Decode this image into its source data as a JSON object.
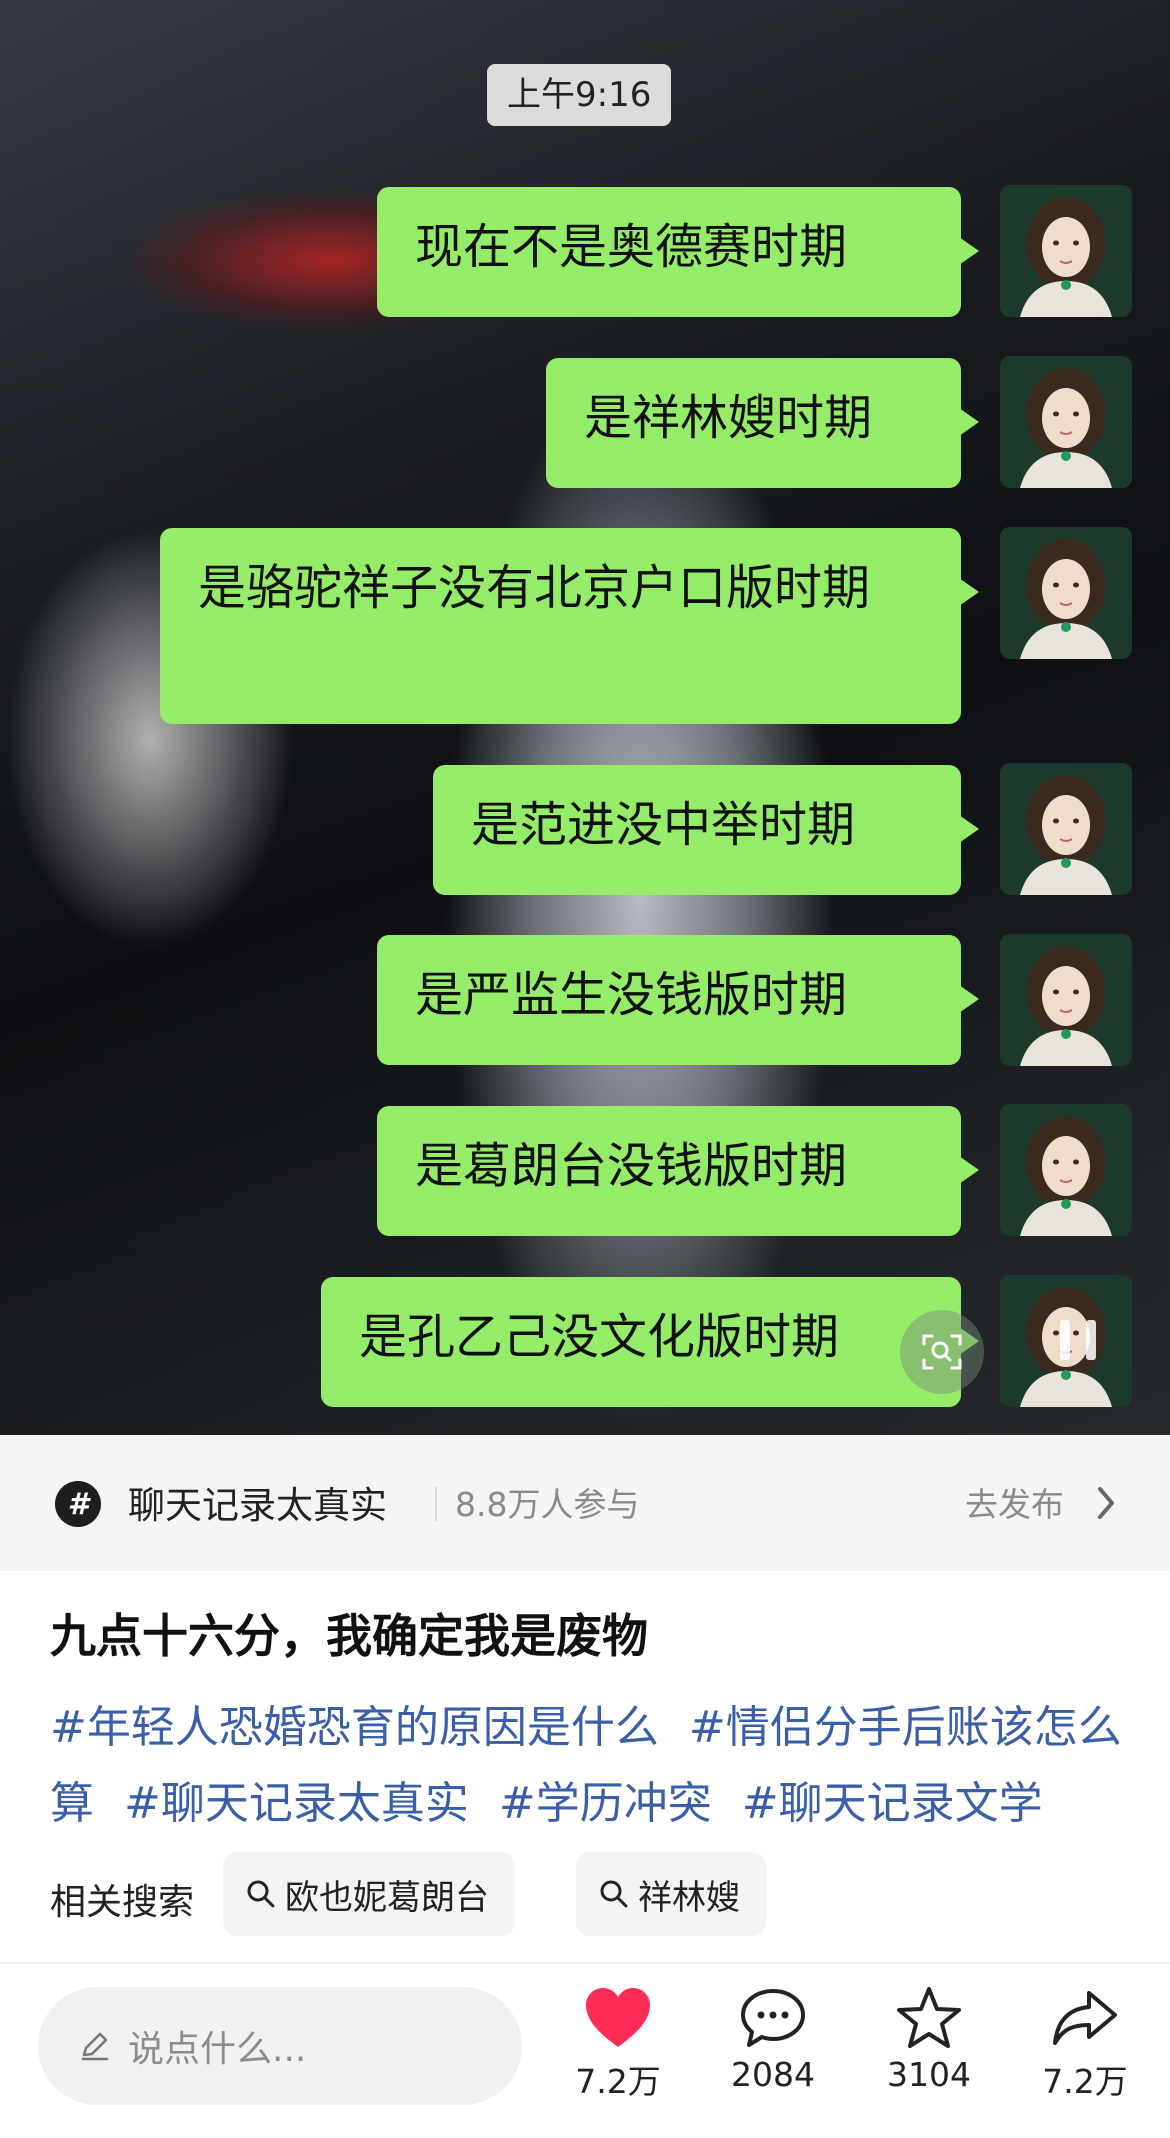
{
  "video": {
    "time": "上午9:16",
    "messages": [
      "现在不是奥德赛时期",
      "是祥林嫂时期",
      "是骆驼祥子没有北京户口版时期",
      "是范进没中举时期",
      "是严监生没钱版时期",
      "是葛朗台没钱版时期",
      "是孔乙己没文化版时期"
    ]
  },
  "topic": {
    "icon": "#",
    "title": "聊天记录太真实",
    "participants": "8.8万人参与",
    "publish": "去发布"
  },
  "post": {
    "title": "九点十六分，我确定我是废物",
    "tags": [
      "#年轻人恐婚恐育的原因是什么",
      "#情侣分手后账该怎么算",
      "#聊天记录太真实",
      "#学历冲突",
      "#聊天记录文学"
    ]
  },
  "related": {
    "label": "相关搜索",
    "chips": [
      "欧也妮葛朗台",
      "祥林嫂"
    ]
  },
  "bottom": {
    "comment_placeholder": "说点什么...",
    "likes": "7.2万",
    "comments": "2084",
    "favorites": "3104",
    "shares": "7.2万"
  },
  "colors": {
    "bubble": "#95ec69",
    "like": "#ff2d55",
    "tag": "#3a5fa8"
  }
}
